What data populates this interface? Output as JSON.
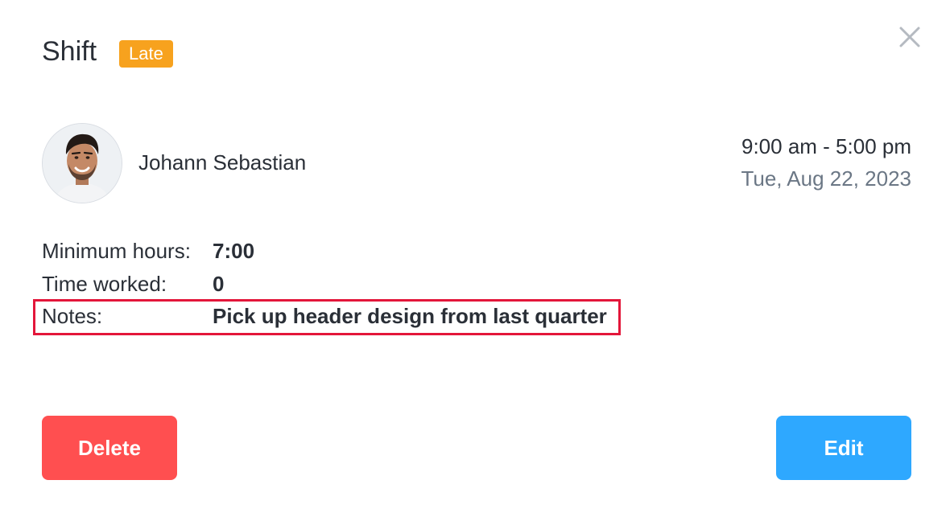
{
  "header": {
    "title": "Shift",
    "badge": "Late",
    "badge_color": "#f7a21e",
    "close_icon": "close-icon"
  },
  "employee": {
    "name": "Johann Sebastian",
    "avatar_icon": "avatar"
  },
  "schedule": {
    "time_range": "9:00 am - 5:00 pm",
    "date": "Tue, Aug 22, 2023"
  },
  "details": {
    "min_hours_label": "Minimum hours:",
    "min_hours_value": "7:00",
    "time_worked_label": "Time worked:",
    "time_worked_value": "0",
    "notes_label": "Notes:",
    "notes_value": "Pick up header design from last quarter"
  },
  "actions": {
    "delete_label": "Delete",
    "delete_color": "#ff4f50",
    "edit_label": "Edit",
    "edit_color": "#2ea8ff"
  },
  "highlight_color": "#e3163a"
}
